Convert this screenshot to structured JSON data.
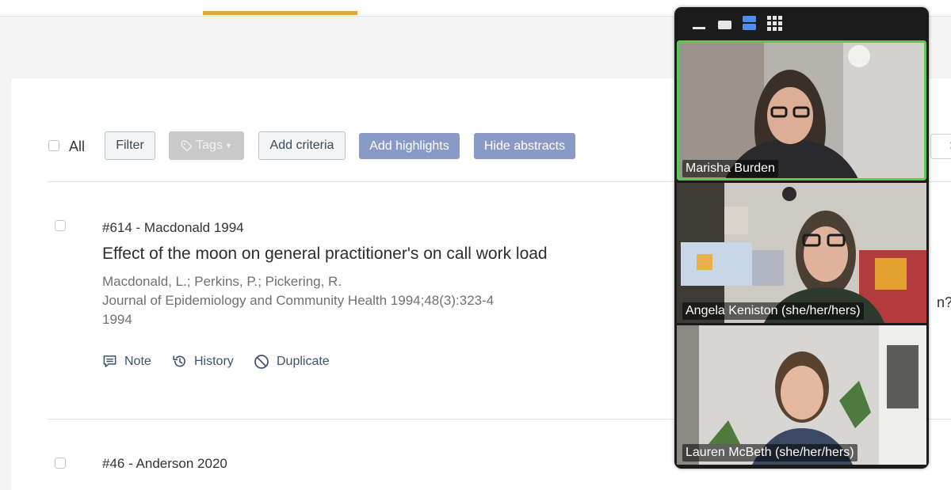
{
  "toolbar": {
    "select_all_label": "All",
    "filter_label": "Filter",
    "tags_label": "Tags",
    "add_criteria_label": "Add criteria",
    "add_highlights_label": "Add highlights",
    "hide_abstracts_label": "Hide abstracts"
  },
  "references": [
    {
      "id_line": "#614 - Macdonald 1994",
      "title": "Effect of the moon on general practitioner's on call work load",
      "authors": "Macdonald, L.; Perkins, P.; Pickering, R.",
      "journal": "Journal of Epidemiology and Community Health 1994;48(3):323-4",
      "year": "1994",
      "actions": [
        "Note",
        "History",
        "Duplicate"
      ]
    },
    {
      "id_line": "#46 - Anderson 2020"
    }
  ],
  "truncated_text": "n?",
  "zoom": {
    "participants": [
      {
        "name": "Marisha Burden",
        "speaking": true
      },
      {
        "name": "Angela Keniston (she/her/hers)",
        "speaking": false
      },
      {
        "name": "Lauren McBeth (she/her/hers)",
        "speaking": false
      }
    ]
  },
  "colors": {
    "accent_tab": "#e8a33d",
    "primary_button": "#8a9ac6",
    "action_link": "#3e5170",
    "speaking_outline": "#58c85a"
  },
  "icons": [
    "tag-icon",
    "caret-down-icon",
    "note-icon",
    "history-icon",
    "duplicate-icon",
    "minimize-icon",
    "speaker-view-icon",
    "gallery-strip-icon",
    "grid-view-icon"
  ]
}
